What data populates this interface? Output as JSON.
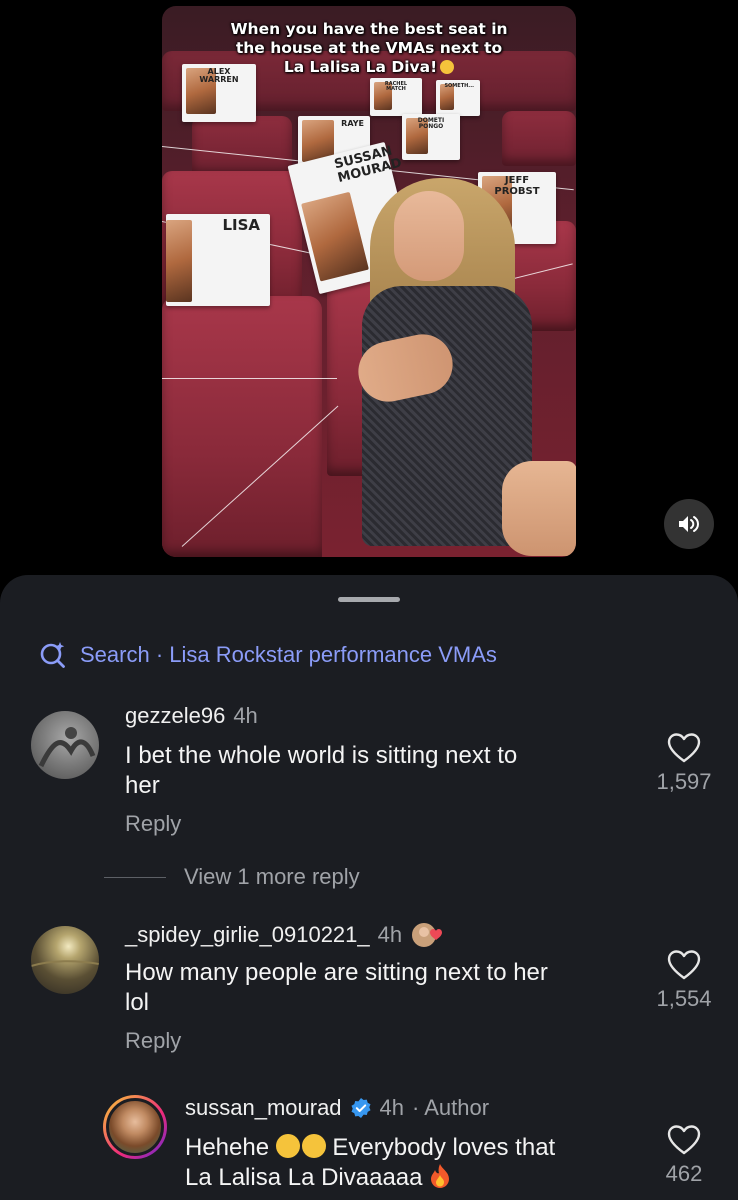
{
  "video": {
    "caption_lines": [
      "When you have the best seat in",
      "the house at the VMAs next to",
      "La Lalisa La Diva!"
    ],
    "caption_emoji": "loudly-crying-face-emoji",
    "seat_cards": [
      "ALEX WARREN",
      "RACHEL MATCH",
      "SOMETH...",
      "RAYE",
      "SUSSAN MOURAD",
      "DOMETI PONGO",
      "JEFF PROBST",
      "LISA"
    ],
    "mute_icon": "speaker-icon"
  },
  "search": {
    "icon": "search-sparkle-icon",
    "text": "Search · Lisa Rockstar performance VMAs"
  },
  "comments": [
    {
      "username": "gezzele96",
      "time": "4h",
      "text_lines": [
        "I bet the whole world is sitting next to",
        "her"
      ],
      "reply_label": "Reply",
      "likes": "1,597"
    },
    {
      "username": "_spidey_girlie_0910221_",
      "time": "4h",
      "text_lines": [
        "How many people are  sitting next to her",
        "lol"
      ],
      "reply_label": "Reply",
      "likes": "1,554"
    }
  ],
  "view_more_replies": "View 1 more reply",
  "reply": {
    "username": "sussan_mourad",
    "time": "4h",
    "author_label": "· Author",
    "text_line1_a": "Hehehe",
    "text_line1_b": "Everybody loves that",
    "text_line2": "La Lalisa La Divaaaaa",
    "likes": "462"
  },
  "colors": {
    "sheet_bg": "#1b1d22",
    "search_accent": "#8b9cf8",
    "muted_text": "#a0a3a8",
    "verified_blue": "#3797f0"
  }
}
